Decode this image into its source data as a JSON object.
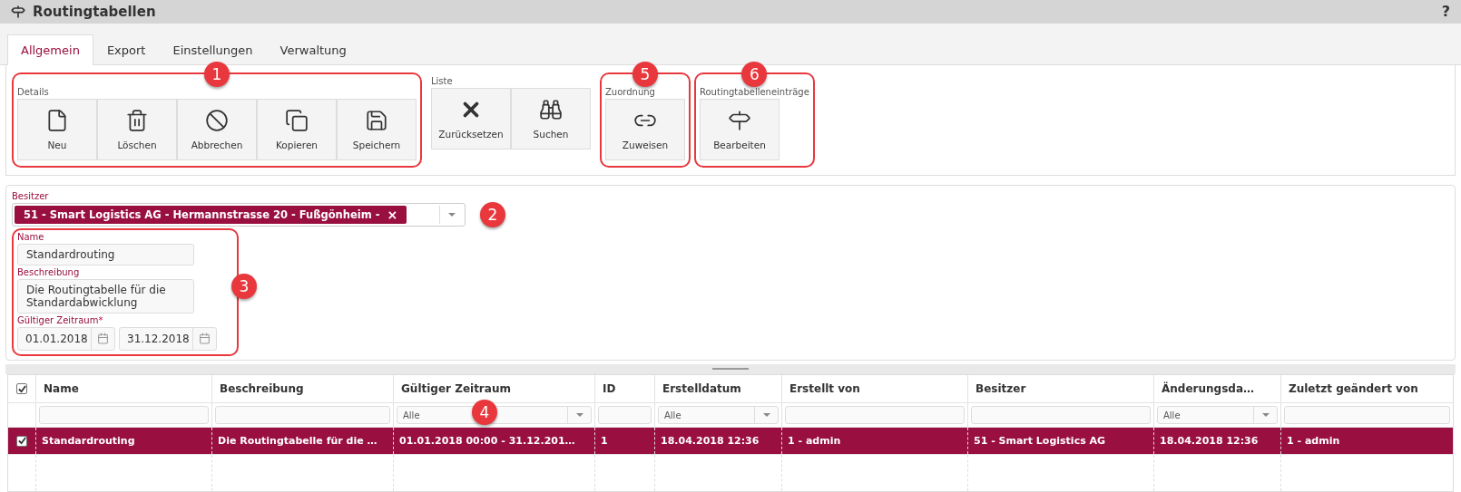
{
  "window": {
    "title": "Routingtabellen",
    "help": "?"
  },
  "tabs": [
    {
      "label": "Allgemein",
      "selected": true
    },
    {
      "label": "Export",
      "selected": false
    },
    {
      "label": "Einstellungen",
      "selected": false
    },
    {
      "label": "Verwaltung",
      "selected": false
    }
  ],
  "toolbar": [
    {
      "label": "Details",
      "annotation": "1",
      "buttons": [
        {
          "kind": "new",
          "label": "Neu"
        },
        {
          "kind": "delete",
          "label": "Löschen"
        },
        {
          "kind": "cancel",
          "label": "Abbrechen"
        },
        {
          "kind": "copy",
          "label": "Kopieren"
        },
        {
          "kind": "save",
          "label": "Speichern"
        }
      ]
    },
    {
      "label": "Liste",
      "buttons": [
        {
          "kind": "reset",
          "label": "Zurücksetzen"
        },
        {
          "kind": "search",
          "label": "Suchen"
        }
      ]
    },
    {
      "label": "Zuordnung",
      "annotation": "5",
      "buttons": [
        {
          "kind": "link",
          "label": "Zuweisen"
        }
      ]
    },
    {
      "label": "Routingtabelleneinträge",
      "annotation": "6",
      "buttons": [
        {
          "kind": "signpost",
          "label": "Bearbeiten"
        }
      ]
    }
  ],
  "form": {
    "owner": {
      "label": "Besitzer",
      "tag": "51 - Smart Logistics AG - Hermannstrasse 20 - Fußgönheim -",
      "remove": "×",
      "annotation": "2"
    },
    "details_annotation": "3",
    "name": {
      "label": "Name",
      "value": "Standardrouting"
    },
    "description": {
      "label": "Beschreibung",
      "value": "Die Routingtabelle für die Standardabwicklung"
    },
    "period": {
      "label": "Gültiger Zeitraum",
      "required": "*",
      "from": "01.01.2018",
      "to": "31.12.2018"
    }
  },
  "table": {
    "annotation": "4",
    "header_checked": true,
    "columns": [
      {
        "label": "Name",
        "kind": "text"
      },
      {
        "label": "Beschreibung",
        "kind": "text"
      },
      {
        "label": "Gültiger Zeitraum",
        "kind": "select",
        "placeholder": "Alle"
      },
      {
        "label": "ID",
        "kind": "text"
      },
      {
        "label": "Erstelldatum",
        "kind": "select",
        "placeholder": "Alle"
      },
      {
        "label": "Erstellt von",
        "kind": "text"
      },
      {
        "label": "Besitzer",
        "kind": "text"
      },
      {
        "label": "Änderungsda…",
        "kind": "select",
        "placeholder": "Alle"
      },
      {
        "label": "Zuletzt geändert von",
        "kind": "text"
      }
    ],
    "rows": [
      {
        "selected": true,
        "checked": true,
        "cells": [
          "Standardrouting",
          "Die Routingtabelle für die …",
          "01.01.2018 00:00 - 31.12.201…",
          "1",
          "18.04.2018 12:36",
          "1 - admin",
          "51 - Smart Logistics AG",
          "18.04.2018 12:36",
          "1 - admin"
        ]
      }
    ]
  }
}
